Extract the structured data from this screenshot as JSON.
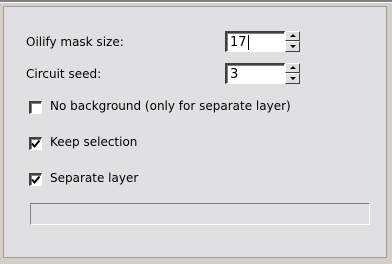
{
  "fields": {
    "mask_label": "Oilify mask size:",
    "mask_value": "17",
    "seed_label": "Circuit seed:",
    "seed_value": "3"
  },
  "options": {
    "no_background": {
      "label": "No background (only for separate layer)",
      "checked": false
    },
    "keep_selection": {
      "label": "Keep selection",
      "checked": true
    },
    "separate_layer": {
      "label": "Separate layer",
      "checked": true
    }
  },
  "status": {
    "text": ""
  }
}
